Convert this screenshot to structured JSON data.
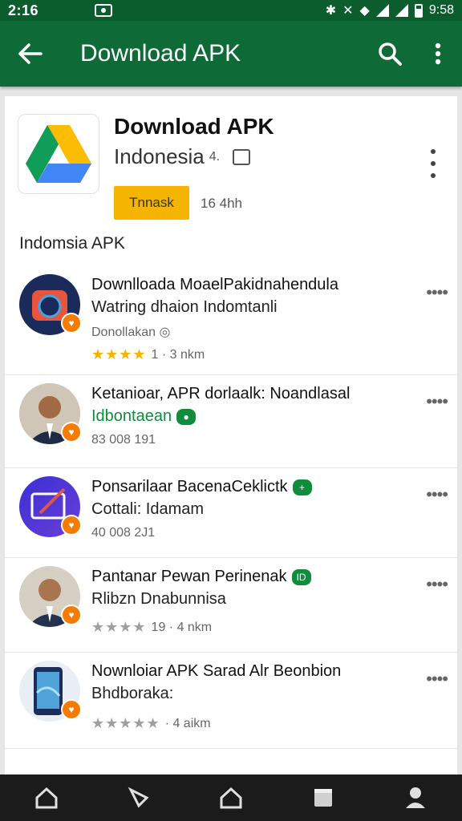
{
  "status_bar": {
    "time": "2:16",
    "right_time": "9:58"
  },
  "app_bar": {
    "title": "Download APK"
  },
  "header": {
    "title": "Download APK",
    "subtitle": "Indonesia",
    "subtitle_glyph": "4.",
    "install_label": "Tnnask",
    "size": "16 4hh"
  },
  "section": {
    "title": "Indomsia APK"
  },
  "items": [
    {
      "title": "Downlloada MoaelPakidnahendula",
      "subtitle": "Watring dhaion Indomtanli",
      "meta": "Donollakan",
      "rating_text": "1 · 3 nkm",
      "stars": "★★★★"
    },
    {
      "title": "Ketanioar, APR dorlaalk: Noandlasal",
      "subtitle": "Idbontaean",
      "meta": "83 008 191"
    },
    {
      "title": "Ponsarilaar BacenaCeklictk",
      "subtitle": "Cottali: Idamam",
      "meta": "40 008 2J1"
    },
    {
      "title": "Pantanar Pewan Perinenak",
      "subtitle": "Rlibzn Dnabunnisa",
      "rating_text": "19 · 4 nkm",
      "stars": "★★★★"
    },
    {
      "title": "Nownloiar APK Sarad Alr Beonbion",
      "subtitle": "Bhdboraka:",
      "rating_text": "· 4 aikm",
      "stars": "★★★★★"
    }
  ],
  "colors": {
    "primary": "#0e6b37",
    "status": "#0b5d2e",
    "accent": "#f4b400",
    "green": "#0f8c3c",
    "badge": "#f57c00"
  }
}
